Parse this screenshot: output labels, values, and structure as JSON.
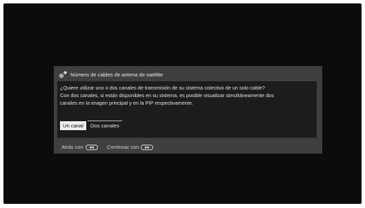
{
  "dialog": {
    "title": "Número de cables de antena de satélite",
    "title_icon": "gear-icon",
    "message_line_1": "¿Quiere utilizar uno o dos canales de transmisión de su sistema colectivo de un solo cable?",
    "message_line_2": "Con dos canales, si están disponibles en su sistema, es posible visualizar simultáneamente dos",
    "message_line_3": "canales en la imagen principal y en la PIP respectivamente.",
    "options": [
      {
        "label": "Un canal",
        "selected": true
      },
      {
        "label": "Dos canales",
        "selected": false
      }
    ]
  },
  "footer": {
    "back_label": "Atrás con",
    "back_icon": "rewind-key-icon",
    "continue_label": "Continuar con",
    "continue_icon": "fast-forward-key-icon"
  },
  "colors": {
    "screen_background": "#0c0c0c",
    "dialog_background": "#3f3f3f",
    "panel_background": "#1c1c1c",
    "selected_option_background": "#ededed",
    "text": "#e6e6e6"
  }
}
